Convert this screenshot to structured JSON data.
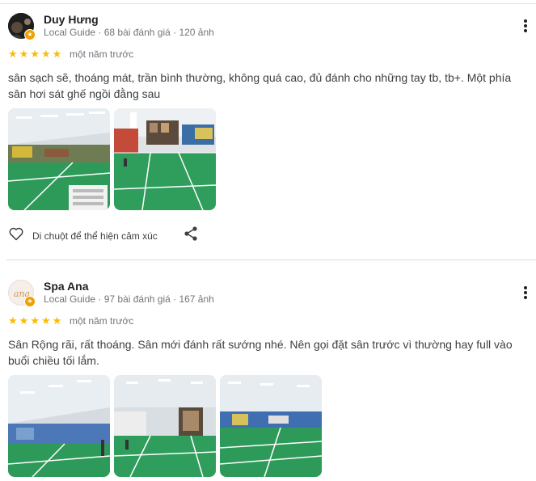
{
  "reviews": [
    {
      "name": "Duy Hưng",
      "meta": "Local Guide · 68 bài đánh giá · 120 ảnh",
      "time": "một năm trước",
      "text": "sân sạch sẽ, thoáng mát, trần bình thường, không quá cao, đủ đánh cho những tay tb, tb+. Một phía sân hơi sát ghế ngồi đằng sau",
      "rating": 5,
      "like_label": "Di chuột để thể hiện cảm xúc"
    },
    {
      "name": "Spa Ana",
      "meta": "Local Guide · 97 bài đánh giá · 167 ảnh",
      "time": "một năm trước",
      "text": "Sân Rộng rãi, rất thoáng. Sân mới đánh rất sướng nhé. Nên gọi đặt sân trước vì thường hay full vào buổi chiều tối lắm.",
      "rating": 5,
      "avatar_text": "ana"
    }
  ],
  "icons": {
    "star": "star-icon",
    "more": "more-vert-icon",
    "heart": "heart-outline-icon",
    "share": "share-icon",
    "badge": "local-guide-badge-icon"
  },
  "colors": {
    "star": "#fbbc04",
    "court_green": "#2e9a5a",
    "badge": "#f0a000"
  }
}
